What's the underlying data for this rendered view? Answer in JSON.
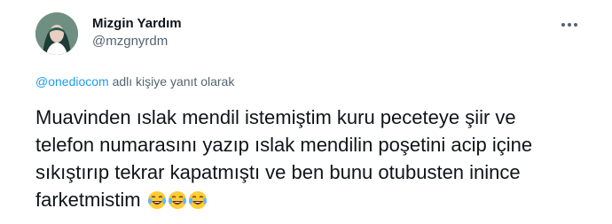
{
  "author": {
    "display_name": "Mizgin Yardım",
    "handle": "@mzgnyrdm"
  },
  "reply": {
    "mention": "@onediocom",
    "suffix": " adlı kişiye yanıt olarak"
  },
  "tweet": {
    "line1": "Muavinden ıslak mendil istemiştim kuru peceteye şiir ve",
    "line2": "telefon numarasını yazıp ıslak mendilin poşetini acip içine",
    "line3": "sıkıştırıp tekrar kapatmıştı ve ben bunu otubusten inince",
    "line4": "farketmistim",
    "emojis": [
      "face-with-tears-of-joy",
      "face-with-tears-of-joy",
      "face-with-tears-of-joy"
    ]
  },
  "icons": {
    "more": "more-options-icon",
    "accent": "#1d9bf0"
  }
}
